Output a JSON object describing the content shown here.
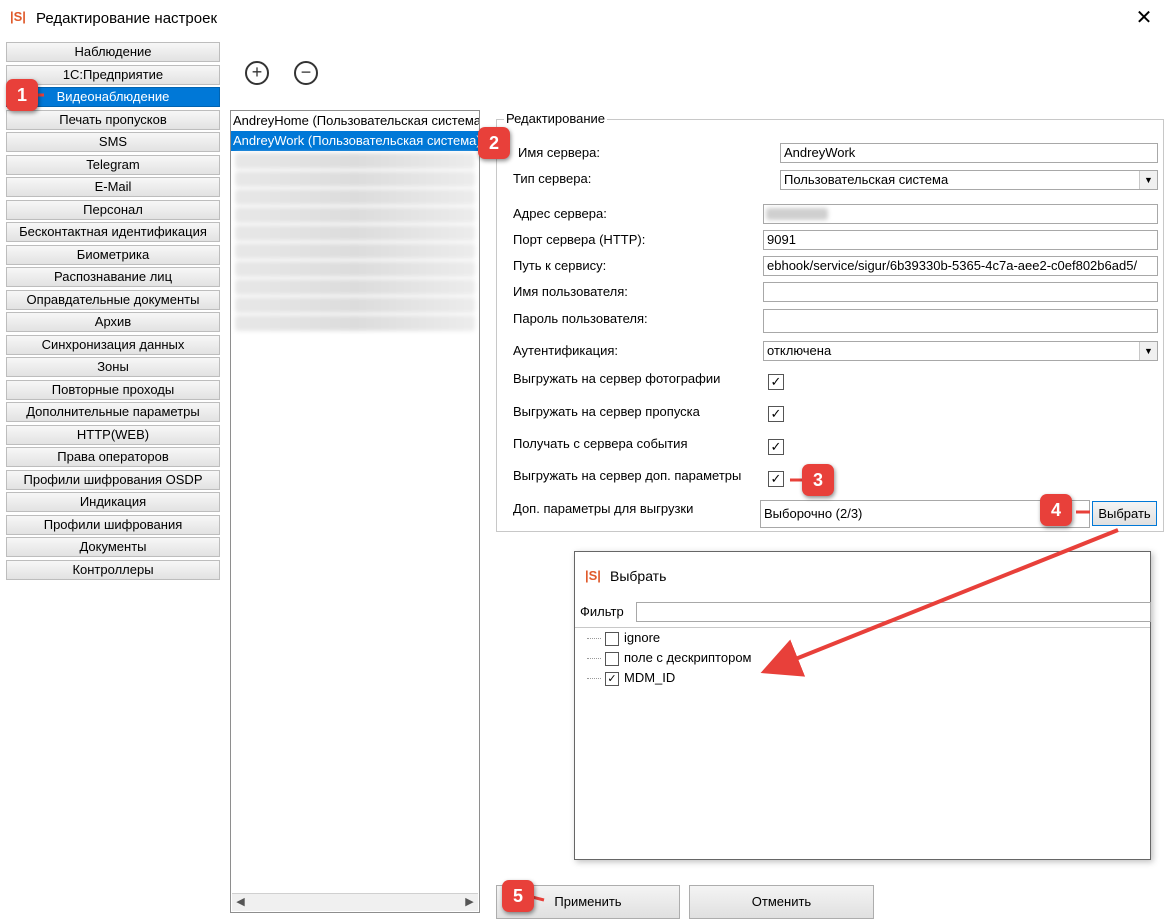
{
  "window": {
    "title": "Редактирование настроек",
    "logo": "|S|",
    "close": "✕"
  },
  "nav": {
    "items": [
      {
        "label": "Наблюдение"
      },
      {
        "label": "1С:Предприятие"
      },
      {
        "label": "Видеонаблюдение"
      },
      {
        "label": "Печать пропусков"
      },
      {
        "label": "SMS"
      },
      {
        "label": "Telegram"
      },
      {
        "label": "E-Mail"
      },
      {
        "label": "Персонал"
      },
      {
        "label": "Бесконтактная идентификация"
      },
      {
        "label": "Биометрика"
      },
      {
        "label": "Распознавание лиц"
      },
      {
        "label": "Оправдательные документы"
      },
      {
        "label": "Архив"
      },
      {
        "label": "Синхронизация данных"
      },
      {
        "label": "Зоны"
      },
      {
        "label": "Повторные проходы"
      },
      {
        "label": "Дополнительные параметры"
      },
      {
        "label": "HTTP(WEB)"
      },
      {
        "label": "Права операторов"
      },
      {
        "label": "Профили шифрования OSDP"
      },
      {
        "label": "Индикация"
      },
      {
        "label": "Профили шифрования"
      },
      {
        "label": "Документы"
      },
      {
        "label": "Контроллеры"
      }
    ],
    "selected_index": 2
  },
  "toolbar": {
    "add_icon": "plus-circle-icon",
    "remove_icon": "minus-circle-icon"
  },
  "servers": [
    {
      "label": "AndreyHome (Пользовательская система)"
    },
    {
      "label": "AndreyWork (Пользовательская система)"
    }
  ],
  "editor": {
    "group_label": "Редактирование",
    "server_name": {
      "label": "Имя сервера:",
      "value": "AndreyWork"
    },
    "server_type": {
      "label": "Тип сервера:",
      "value": "Пользовательская система"
    },
    "server_address": {
      "label": "Адрес сервера:",
      "value": ""
    },
    "server_port": {
      "label": "Порт сервера (HTTP):",
      "value": "9091"
    },
    "service_path": {
      "label": "Путь к сервису:",
      "value": "ebhook/service/sigur/6b39330b-5365-4c7a-aee2-c0ef802b6ad5/"
    },
    "username": {
      "label": "Имя пользователя:",
      "value": ""
    },
    "password": {
      "label": "Пароль пользователя:",
      "value": ""
    },
    "auth": {
      "label": "Аутентификация:",
      "value": "отключена"
    },
    "upload_photos": {
      "label": "Выгружать на сервер фотографии",
      "checked": true
    },
    "upload_passes": {
      "label": "Выгружать на сервер пропуска",
      "checked": true
    },
    "receive_events": {
      "label": "Получать с сервера события",
      "checked": true
    },
    "upload_extra": {
      "label": "Выгружать на сервер доп. параметры",
      "checked": true
    },
    "extra_params": {
      "label": "Доп. параметры для выгрузки",
      "value": "Выборочно (2/3)",
      "button": "Выбрать"
    }
  },
  "popup": {
    "logo": "|S|",
    "title": "Выбрать",
    "filter_label": "Фильтр",
    "filter_value": "",
    "items": [
      {
        "label": "ignore",
        "checked": false
      },
      {
        "label": "поле с дескриптором",
        "checked": false
      },
      {
        "label": "MDM_ID",
        "checked": true
      }
    ]
  },
  "buttons": {
    "apply": "Применить",
    "cancel": "Отменить"
  },
  "badges": [
    "1",
    "2",
    "3",
    "4",
    "5"
  ],
  "colors": {
    "selection": "#0078d7",
    "badge": "#e8403a",
    "logo": "#e05a2b"
  }
}
